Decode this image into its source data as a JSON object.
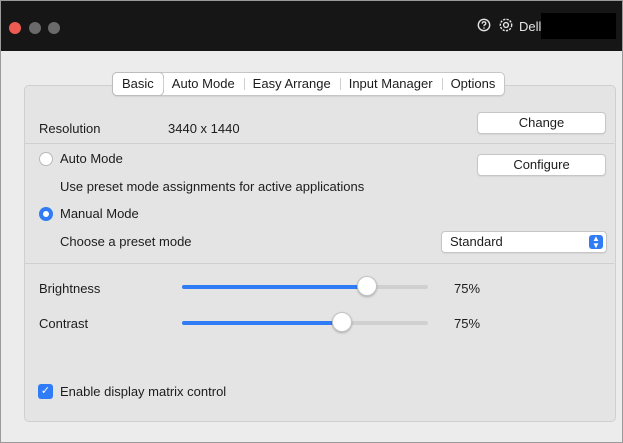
{
  "titlebar": {
    "brand": "Dell",
    "icons": [
      "help-icon",
      "gear-icon"
    ]
  },
  "tabs": [
    {
      "label": "Basic",
      "active": true
    },
    {
      "label": "Auto Mode",
      "active": false
    },
    {
      "label": "Easy Arrange",
      "active": false
    },
    {
      "label": "Input Manager",
      "active": false
    },
    {
      "label": "Options",
      "active": false
    }
  ],
  "resolution": {
    "label": "Resolution",
    "value": "3440 x 1440",
    "button": "Change"
  },
  "mode": {
    "auto_label": "Auto Mode",
    "auto_selected": false,
    "configure_button": "Configure",
    "auto_description": "Use preset mode assignments for active applications",
    "manual_label": "Manual Mode",
    "manual_selected": true,
    "preset_label": "Choose a preset mode",
    "preset_value": "Standard"
  },
  "sliders": {
    "brightness": {
      "label": "Brightness",
      "percent_text": "75%",
      "value": 0.75
    },
    "contrast": {
      "label": "Contrast",
      "percent_text": "75%",
      "value": 0.65
    }
  },
  "matrix": {
    "label": "Enable display matrix control",
    "checked": true
  },
  "colors": {
    "accent": "#2f7cf6",
    "titlebar": "#161616",
    "close": "#ee5b52"
  }
}
